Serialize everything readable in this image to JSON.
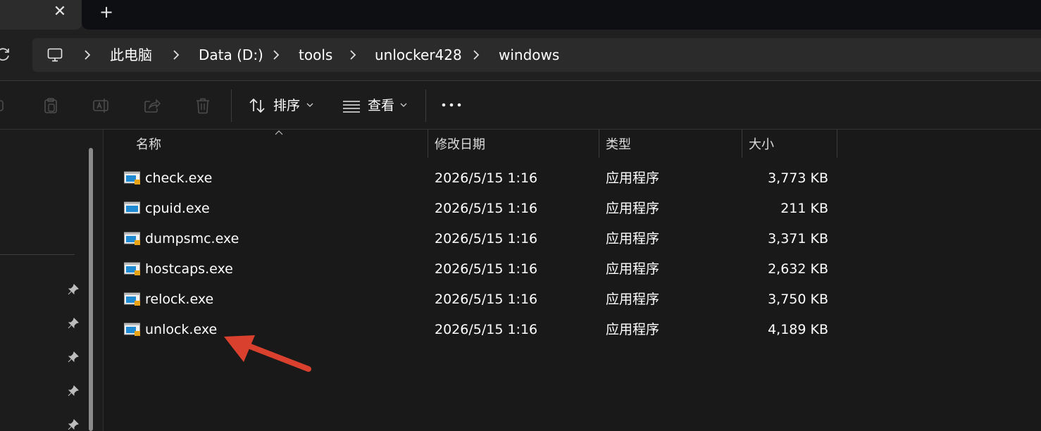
{
  "tabs": {
    "close_glyph": "✕",
    "new_glyph": "+"
  },
  "address": {
    "crumbs": [
      "此电脑",
      "Data (D:)",
      "tools",
      "unlocker428",
      "windows"
    ]
  },
  "toolbar": {
    "sort_label": "排序",
    "view_label": "查看"
  },
  "columns": {
    "name": "名称",
    "modified": "修改日期",
    "type": "类型",
    "size": "大小"
  },
  "files": [
    {
      "name": "check.exe",
      "modified": "2026/5/15 1:16",
      "type": "应用程序",
      "size": "3,773 KB"
    },
    {
      "name": "cpuid.exe",
      "modified": "2026/5/15 1:16",
      "type": "应用程序",
      "size": "211 KB"
    },
    {
      "name": "dumpsmc.exe",
      "modified": "2026/5/15 1:16",
      "type": "应用程序",
      "size": "3,371 KB"
    },
    {
      "name": "hostcaps.exe",
      "modified": "2026/5/15 1:16",
      "type": "应用程序",
      "size": "2,632 KB"
    },
    {
      "name": "relock.exe",
      "modified": "2026/5/15 1:16",
      "type": "应用程序",
      "size": "3,750 KB"
    },
    {
      "name": "unlock.exe",
      "modified": "2026/5/15 1:16",
      "type": "应用程序",
      "size": "4,189 KB"
    }
  ],
  "colors": {
    "background": "#191919",
    "address_bar": "#2b2b2b",
    "annotation_arrow": "#d9412e",
    "exe_icon_blue": "#1f8ad2"
  }
}
